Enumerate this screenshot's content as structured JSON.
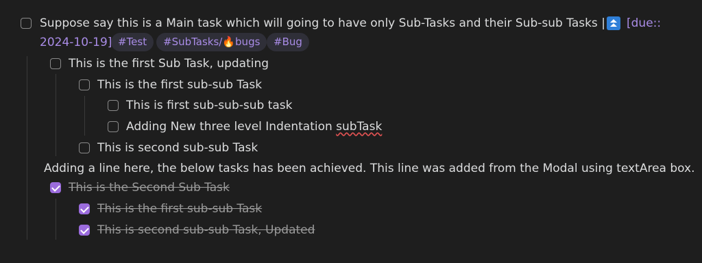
{
  "main_task": {
    "text_line1": "Suppose say this  is a Main task which will going to have only Sub-Tasks and their Sub-sub Tasks |",
    "priority_icon": "highest-priority-icon",
    "due_label": "[due::",
    "due_date": "2024-10-19]",
    "tags": [
      "#Test",
      "#SubTasks/🔥bugs",
      "#Bug"
    ],
    "checked": false
  },
  "subtasks": [
    {
      "text": "This is the first Sub Task, updating",
      "checked": false
    },
    {
      "text": "This is the first sub-sub Task",
      "checked": false
    },
    {
      "text": "This is first sub-sub-sub task",
      "checked": false
    },
    {
      "text_prefix": "Adding New three level Indentation ",
      "text_flagged": "subTask",
      "checked": false
    },
    {
      "text": "This is second sub-sub Task",
      "checked": false
    }
  ],
  "note_line": "Adding a line here, the below tasks has been achieved. This line was added from the Modal using textArea box.",
  "completed": [
    {
      "text": "This is the Second Sub Task",
      "checked": true
    },
    {
      "text": "This is the first sub-sub Task",
      "checked": true
    },
    {
      "text": "This is second sub-sub Task, Updated",
      "checked": true
    }
  ],
  "colors": {
    "background": "#1e1e1e",
    "text": "#dcddde",
    "accent": "#9b6cdd",
    "tag_text": "#a98ce6",
    "tag_bg": "#2f2f38",
    "priority_icon": "#2f7fd8"
  }
}
